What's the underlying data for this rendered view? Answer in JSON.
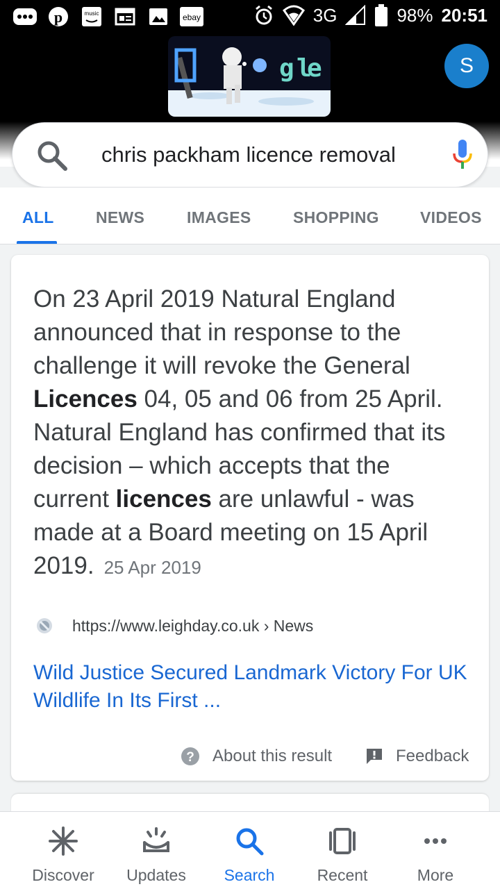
{
  "status_bar": {
    "left_icons": [
      "more-icon",
      "pinterest-icon",
      "amazon-music-icon",
      "news-icon",
      "gallery-icon",
      "ebay-icon"
    ],
    "music_label": "music",
    "ebay_label": "ebay",
    "network": "3G",
    "battery": "98%",
    "time": "20:51"
  },
  "header": {
    "doodle_text": "Google",
    "avatar_initial": "S"
  },
  "search": {
    "query": "chris packham licence removal"
  },
  "tabs": [
    "ALL",
    "NEWS",
    "IMAGES",
    "SHOPPING",
    "VIDEOS"
  ],
  "result": {
    "snippet_1": "On 23 April 2019 Natural England announced that in response to the challenge it will revoke the General ",
    "bold_1": "Licences",
    "snippet_2": " 04, 05 and 06 from 25 April. Natural England has confirmed that its decision – which accepts that the current ",
    "bold_2": "licences",
    "snippet_3": " are unlawful - was made at a Board meeting on 15 April 2019.",
    "date": "25 Apr 2019",
    "url": "https://www.leighday.co.uk › News",
    "title": "Wild Justice Secured Landmark Victory For UK Wildlife In Its First ...",
    "about_label": "About this result",
    "feedback_label": "Feedback"
  },
  "bottom_nav": {
    "discover": "Discover",
    "updates": "Updates",
    "search": "Search",
    "recent": "Recent",
    "more": "More"
  },
  "colors": {
    "accent": "#1a73e8",
    "link": "#1967d2",
    "avatar": "#1a7fcc"
  }
}
